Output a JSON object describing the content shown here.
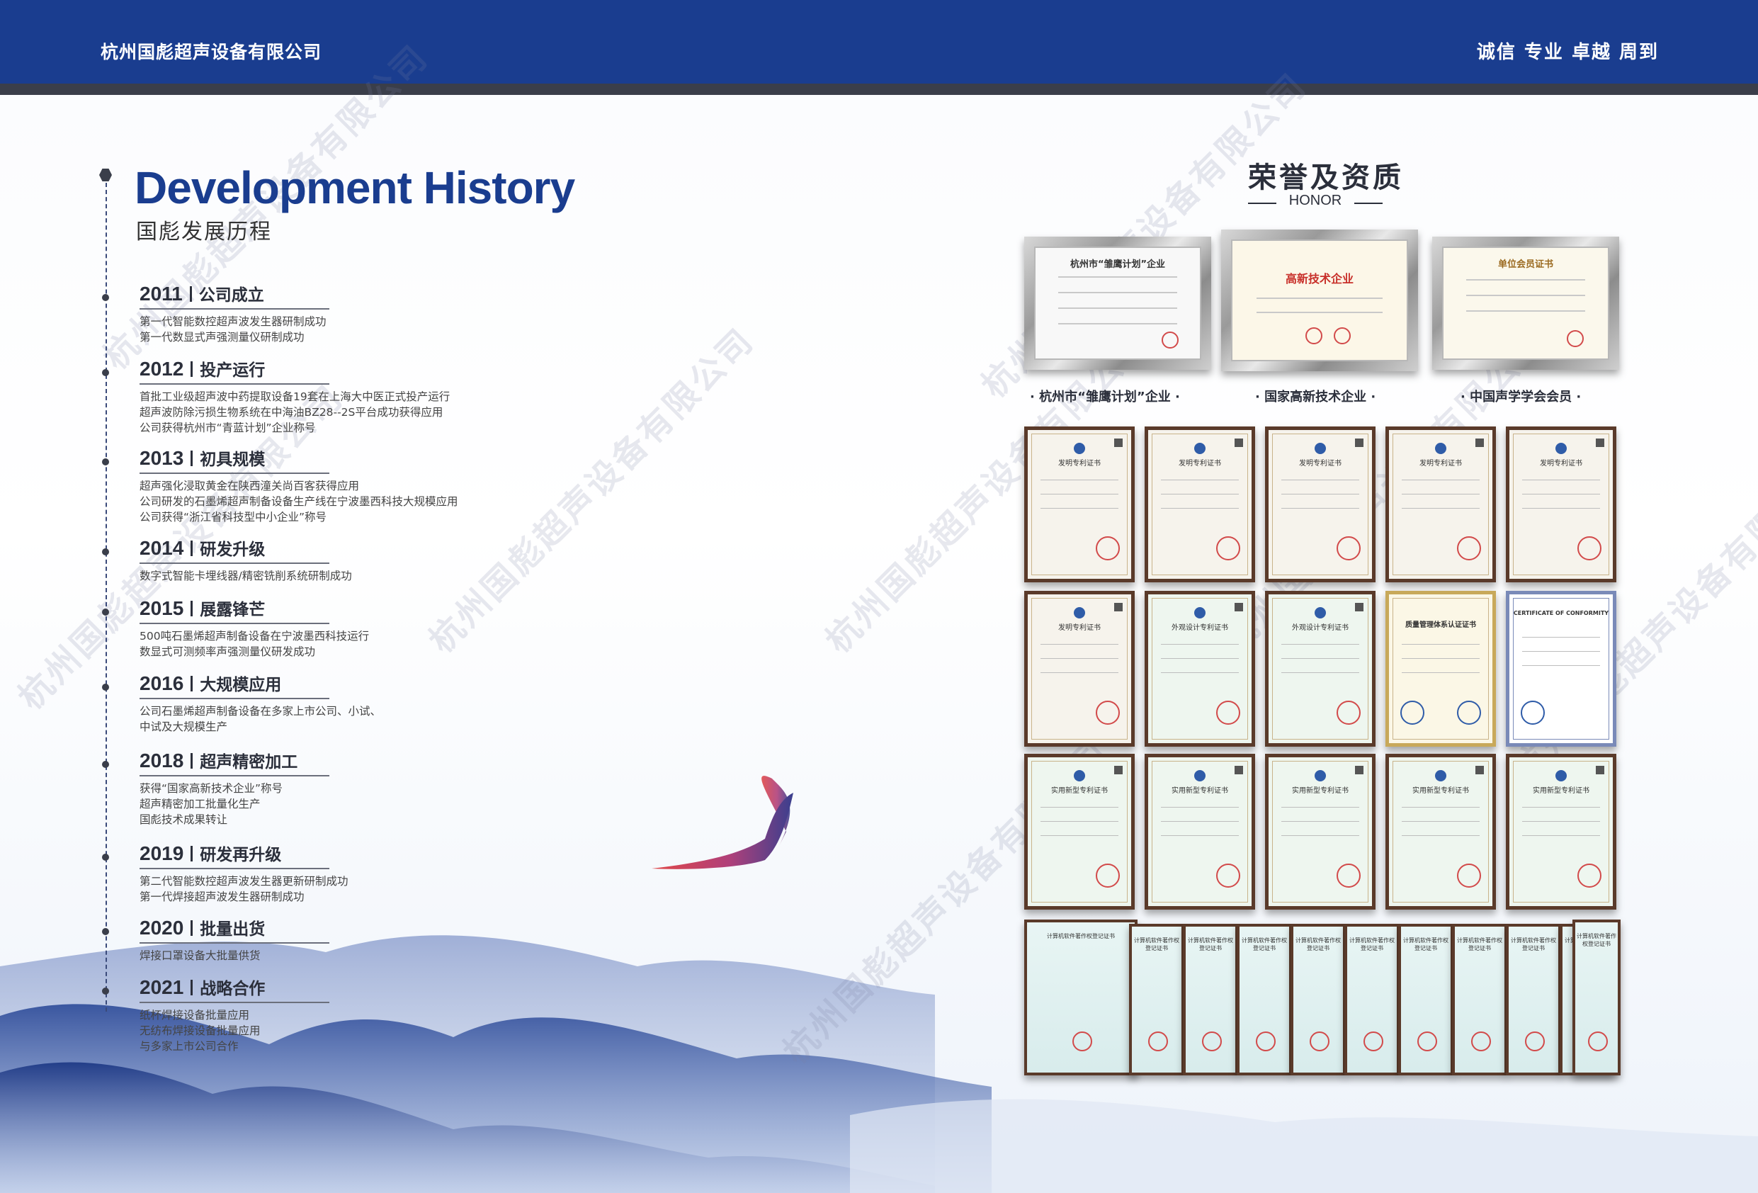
{
  "header": {
    "company": "杭州国彪超声设备有限公司",
    "slogan": "诚信 专业 卓越 周到",
    "color": "#1a3d8f"
  },
  "watermark_text": "杭州国彪超声设备有限公司",
  "history": {
    "title_en": "Development History",
    "title_cn": "国彪发展历程",
    "items": [
      {
        "year": "2011",
        "label": "公司成立",
        "lines": [
          "第一代智能数控超声波发生器研制成功",
          "第一代数显式声强测量仪研制成功"
        ]
      },
      {
        "year": "2012",
        "label": "投产运行",
        "lines": [
          "首批工业级超声波中药提取设备19套在上海大中医正式投产运行",
          "超声波防除污损生物系统在中海油BZ28--2S平台成功获得应用",
          "公司获得杭州市“青蓝计划”企业称号"
        ]
      },
      {
        "year": "2013",
        "label": "初具规模",
        "lines": [
          "超声强化浸取黄金在陕西潼关尚百客获得应用",
          "公司研发的石墨烯超声制备设备生产线在宁波墨西科技大规模应用",
          "公司获得“浙江省科技型中小企业”称号"
        ]
      },
      {
        "year": "2014",
        "label": "研发升级",
        "lines": [
          "数字式智能卡埋线器/精密铣削系统研制成功"
        ]
      },
      {
        "year": "2015",
        "label": "展露锋芒",
        "lines": [
          "500吨石墨烯超声制备设备在宁波墨西科技运行",
          "数显式可测频率声强测量仪研发成功"
        ]
      },
      {
        "year": "2016",
        "label": "大规模应用",
        "lines": [
          "公司石墨烯超声制备设备在多家上市公司、小试、",
          "中试及大规模生产"
        ]
      },
      {
        "year": "2018",
        "label": "超声精密加工",
        "lines": [
          "获得“国家高新技术企业”称号",
          "超声精密加工批量化生产",
          "国彪技术成果转让"
        ]
      },
      {
        "year": "2019",
        "label": "研发再升级",
        "lines": [
          "第二代智能数控超声波发生器更新研制成功",
          "第一代焊接超声波发生器研制成功"
        ]
      },
      {
        "year": "2020",
        "label": "批量出货",
        "lines": [
          "焊接口罩设备大批量供货"
        ]
      },
      {
        "year": "2021",
        "label": "战略合作",
        "lines": [
          "纸杯焊接设备批量应用",
          "无纺布焊接设备批量应用",
          "与多家上市公司合作"
        ]
      }
    ]
  },
  "honor": {
    "title": "荣誉及资质",
    "subtitle": "HONOR",
    "plaques": [
      {
        "heading": "杭州市“雏鹰计划”企业",
        "inner": "杭州市“雏鹰计划”企业",
        "caption": "· 杭州市“雏鹰计划”企业 ·"
      },
      {
        "heading": "高新技术企业",
        "inner": "高新技术企业",
        "caption": "· 国家高新技术企业 ·"
      },
      {
        "heading": "单位会员证书",
        "inner": "单位会员证书",
        "caption": "· 中国声学学会会员 ·"
      }
    ],
    "cert_rows": [
      [
        "发明专利证书",
        "发明专利证书",
        "发明专利证书",
        "发明专利证书",
        "发明专利证书"
      ],
      [
        "发明专利证书",
        "外观设计专利证书",
        "外观设计专利证书",
        "质量管理体系认证证书",
        "CERTIFICATE OF CONFORMITY"
      ],
      [
        "实用新型专利证书",
        "实用新型专利证书",
        "实用新型专利证书",
        "实用新型专利证书",
        "实用新型专利证书"
      ]
    ],
    "copyright_certs": [
      "计算机软件著作权登记证书",
      "计算机软件著作权登记证书",
      "计算机软件著作权登记证书",
      "计算机软件著作权登记证书",
      "计算机软件著作权登记证书",
      "计算机软件著作权登记证书",
      "计算机软件著作权登记证书",
      "计算机软件著作权登记证书",
      "计算机软件著作权登记证书",
      "计算机软件著作权登记证书",
      "计算机软件著作权登记证书"
    ]
  }
}
